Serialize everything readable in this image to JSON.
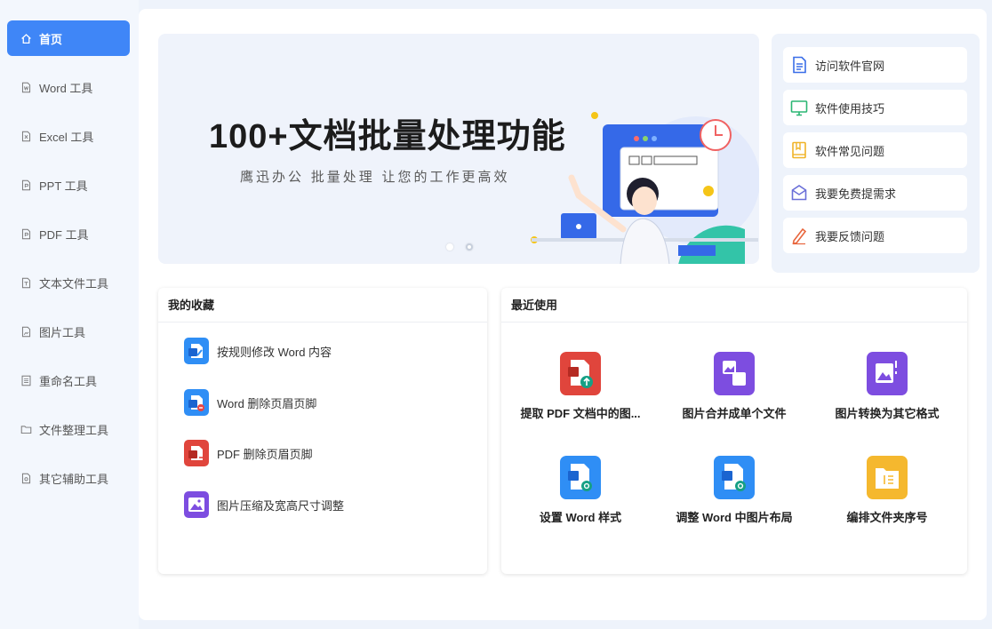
{
  "sidebar": {
    "items": [
      {
        "label": "首页",
        "icon": "home-icon",
        "active": true
      },
      {
        "label": "Word 工具",
        "icon": "file-icon"
      },
      {
        "label": "Excel 工具",
        "icon": "file-icon"
      },
      {
        "label": "PPT 工具",
        "icon": "file-icon"
      },
      {
        "label": "PDF 工具",
        "icon": "file-icon"
      },
      {
        "label": "文本文件工具",
        "icon": "file-icon"
      },
      {
        "label": "图片工具",
        "icon": "image-file-icon"
      },
      {
        "label": "重命名工具",
        "icon": "list-icon"
      },
      {
        "label": "文件整理工具",
        "icon": "folder-icon"
      },
      {
        "label": "其它辅助工具",
        "icon": "tool-file-icon"
      }
    ]
  },
  "banner": {
    "title": "100+文档批量处理功能",
    "subtitle": "鹰迅办公 批量处理 让您的工作更高效",
    "slide_index": 2,
    "slide_count": 2
  },
  "quick_links": [
    {
      "label": "访问软件官网",
      "icon": "document-icon",
      "color": "#3a6ee8"
    },
    {
      "label": "软件使用技巧",
      "icon": "monitor-icon",
      "color": "#2bb673"
    },
    {
      "label": "软件常见问题",
      "icon": "book-icon",
      "color": "#f0b429"
    },
    {
      "label": "我要免费提需求",
      "icon": "mail-icon",
      "color": "#6a6fd8"
    },
    {
      "label": "我要反馈问题",
      "icon": "pencil-icon",
      "color": "#e8663d"
    }
  ],
  "favorites": {
    "title": "我的收藏",
    "items": [
      {
        "label": "按规则修改 Word 内容",
        "icon": "word-edit-icon",
        "color": "#2f8ef5"
      },
      {
        "label": "Word 删除页眉页脚",
        "icon": "word-remove-icon",
        "color": "#2f8ef5"
      },
      {
        "label": "PDF 删除页眉页脚",
        "icon": "pdf-remove-icon",
        "color": "#e0453c"
      },
      {
        "label": "图片压缩及宽高尺寸调整",
        "icon": "image-resize-icon",
        "color": "#7d4de0"
      }
    ]
  },
  "recent": {
    "title": "最近使用",
    "items": [
      {
        "label": "提取 PDF 文档中的图...",
        "icon": "pdf-extract-icon",
        "color": "#e0453c"
      },
      {
        "label": "图片合并成单个文件",
        "icon": "image-merge-icon",
        "color": "#7d4de0"
      },
      {
        "label": "图片转换为其它格式",
        "icon": "image-convert-icon",
        "color": "#7d4de0"
      },
      {
        "label": "设置 Word 样式",
        "icon": "word-style-icon",
        "color": "#2f8ef5"
      },
      {
        "label": "调整 Word 中图片布局",
        "icon": "word-image-icon",
        "color": "#2f8ef5"
      },
      {
        "label": "编排文件夹序号",
        "icon": "folder-number-icon",
        "color": "#f5b82e"
      }
    ]
  }
}
